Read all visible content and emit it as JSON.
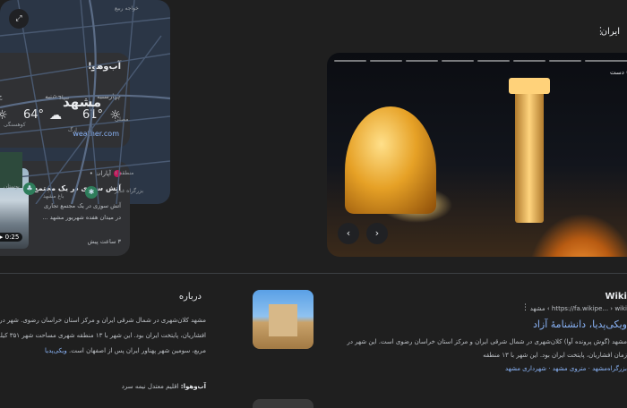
{
  "topbar": {
    "label": "ایران",
    "menu_icon": "more-vert-icon"
  },
  "weather": {
    "title": "آب‌وهوا",
    "days": [
      {
        "day": "چهارشنبه",
        "temp": "61°",
        "icon": "sun-icon"
      },
      {
        "day": "پنجشنبه",
        "temp": "64°",
        "icon": "cloud-icon"
      },
      {
        "day": "ج",
        "temp": "",
        "icon": "sun-icon"
      }
    ],
    "source": "weather.com"
  },
  "news": {
    "source": "آپارات •",
    "headline": "آتش سوزی در یک مجتمع",
    "snippet_1": "آتش سوزی در یک مجتمع تجاری",
    "snippet_2": "در میدان هفده شهریور مشهد ...",
    "time": "۳ ساعت پیش",
    "duration": "0:25"
  },
  "map": {
    "city": "مشهد",
    "labels": [
      "خواجه ربیع",
      "سباد",
      "کوهسنگی",
      "مصلی",
      "باغ مشهد",
      "بوستان",
      "ارگ",
      "بزرگراه غدیر",
      "منطقه ۱"
    ]
  },
  "photo": {
    "caption": "(2) دست‌"
  },
  "about": {
    "title": "درباره",
    "text": "مشهد کلان‌شهری در شمال شرقی ایران و مرکز استان خراسان رضوی. شهر در زمان افشاریان، پایتخت ایران بود. این شهر با ۱۳ منطقه شهری مساحت شهر ۳۵۱ کیلومتر مربع، سومین شهر پهناور ایران پس از اصفهان است.",
    "link": "ویکی‌پدیا",
    "climate_label": "آب‌وهوا:",
    "climate_value": "اقلیم معتدل نیمه سرد"
  },
  "wiki": {
    "site": "Wiki",
    "url": "https://fa.wikipe... › wiki › مشهد",
    "title": "ویکی‌پدیا، دانشنامهٔ آزاد",
    "snippet": "مشهد (گوش پرونده آوا) کلان‌شهری در شمال شرقی ایران و مرکز استان خراسان رضوی است. این شهر در زمان افشاریان، پایتخت ایران بود. این شهر با ۱۳ منطقه",
    "links": "بزرگراه‌مشهد · متروی مشهد · شهرداری مشهد"
  }
}
